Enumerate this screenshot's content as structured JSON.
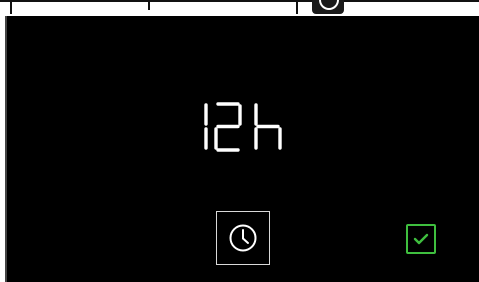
{
  "display": {
    "value_text": "12h",
    "digit_color": "#ffffff"
  },
  "controls": {
    "clock_icon": "clock-icon",
    "confirm_icon": "check-icon",
    "confirm_color": "#3fbf3f"
  }
}
